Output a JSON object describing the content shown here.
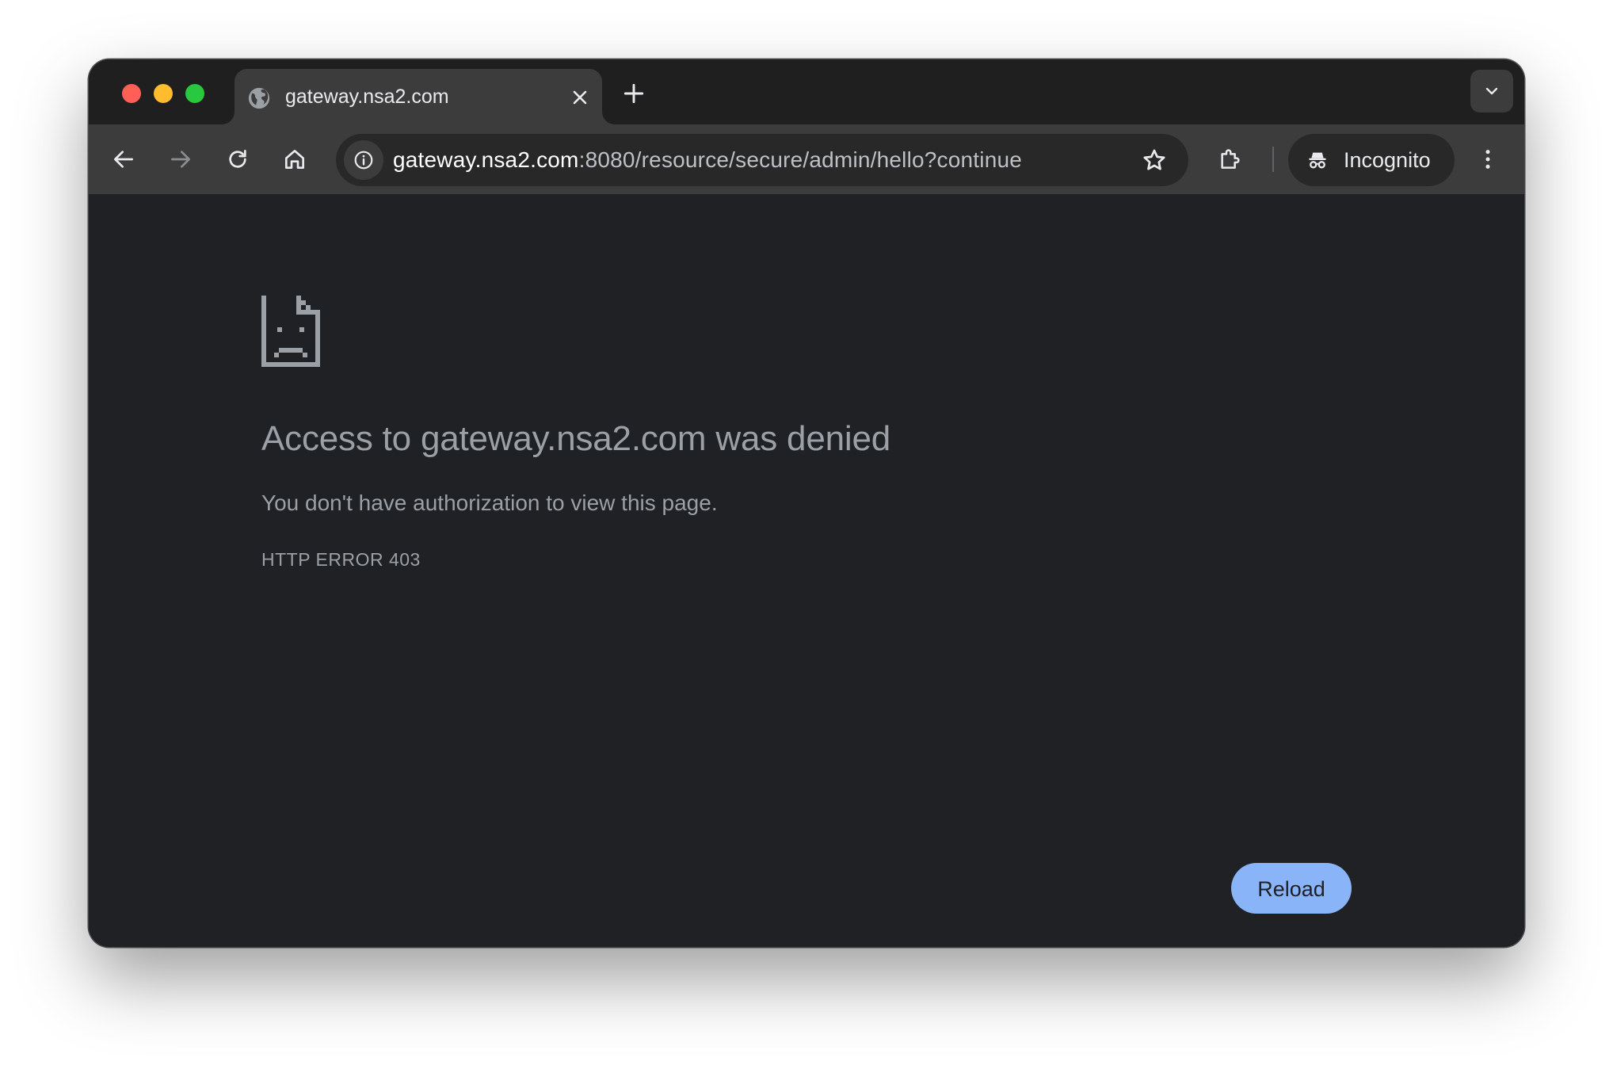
{
  "window": {
    "traffic_lights": [
      "close",
      "minimize",
      "zoom"
    ]
  },
  "tab": {
    "title": "gateway.nsa2.com",
    "favicon": "globe-icon",
    "close_icon": "close-icon"
  },
  "tabstrip": {
    "new_tab_icon": "plus-icon",
    "tab_search_icon": "chevron-down-icon"
  },
  "toolbar": {
    "back_icon": "back-arrow-icon",
    "forward_icon": "forward-arrow-icon",
    "reload_icon": "reload-icon",
    "home_icon": "home-icon",
    "omnibox": {
      "info_icon": "info-icon",
      "url_host": "gateway.nsa2.com",
      "url_rest": ":8080/resource/secure/admin/hello?continue",
      "bookmark_icon": "star-icon"
    },
    "extensions_icon": "puzzle-icon",
    "incognito_label": "Incognito",
    "incognito_icon": "incognito-icon",
    "menu_icon": "kebab-menu-icon"
  },
  "page": {
    "error_icon": "sad-document-icon",
    "heading": "Access to gateway.nsa2.com was denied",
    "description": "You don't have authorization to view this page.",
    "error_code": "HTTP ERROR 403",
    "reload_label": "Reload"
  },
  "colors": {
    "window_bg": "#202124",
    "toolbar_bg": "#3c3c3c",
    "accent": "#8ab4f8",
    "text_muted": "#9aa0a6"
  }
}
